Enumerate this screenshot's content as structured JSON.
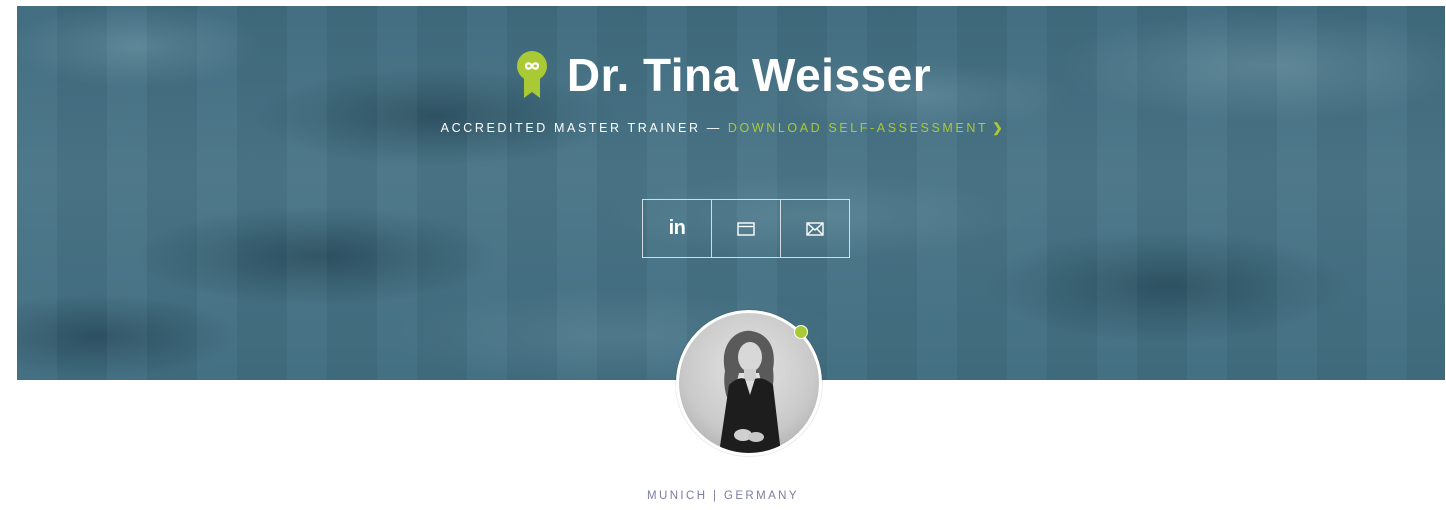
{
  "profile": {
    "name": "Dr. Tina Weisser",
    "role": "ACCREDITED MASTER TRAINER",
    "separator": "—",
    "download_link": "DOWNLOAD SELF-ASSESSMENT",
    "download_chevron": "❯",
    "location": "MUNICH | GERMANY",
    "status": "online"
  },
  "social": {
    "linkedin_label": "in",
    "buttons": [
      "linkedin-icon",
      "website-icon",
      "envelope-icon"
    ]
  },
  "colors": {
    "accent": "#a9c935",
    "hero_bg": "#45717f",
    "location_text": "#7b7fa0"
  },
  "icons": {
    "badge": "award-ribbon-infinity-icon"
  }
}
